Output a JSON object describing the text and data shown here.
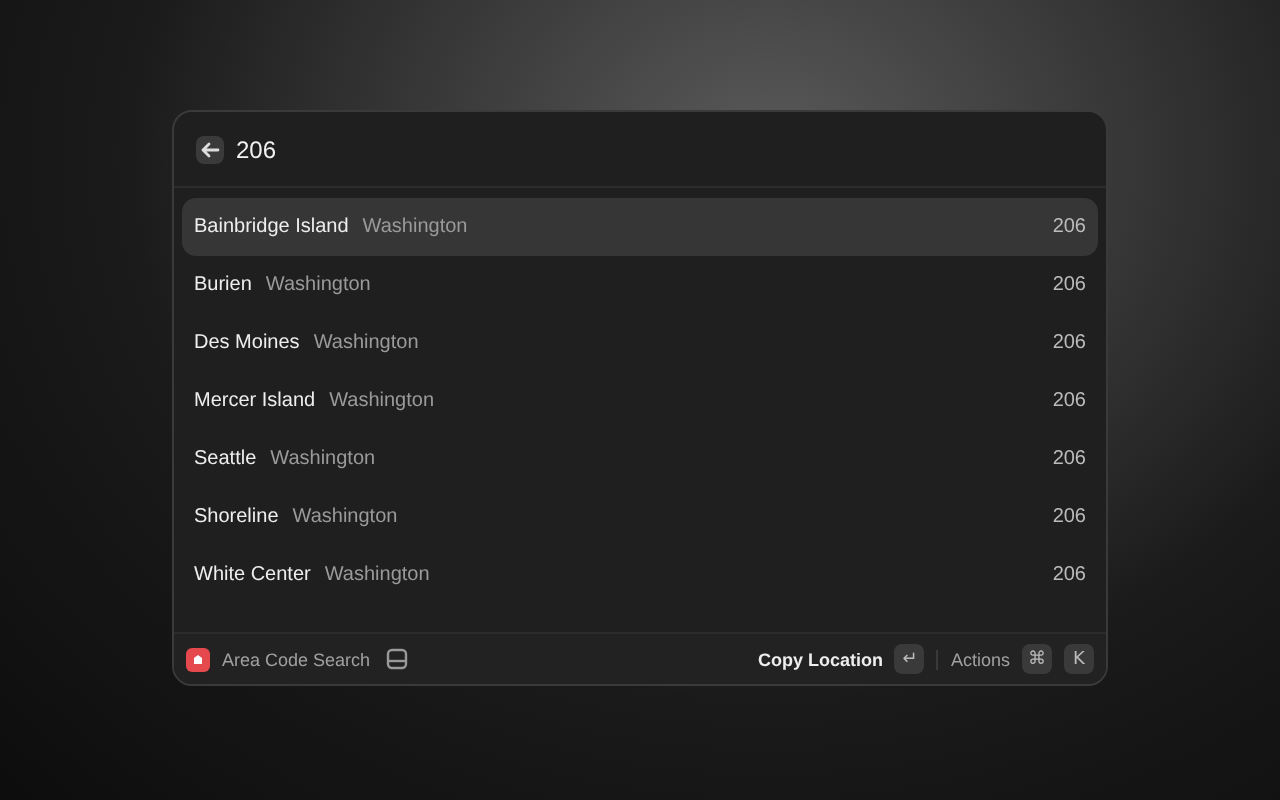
{
  "search": {
    "value": "206"
  },
  "results": [
    {
      "city": "Bainbridge Island",
      "state": "Washington",
      "code": "206",
      "selected": true
    },
    {
      "city": "Burien",
      "state": "Washington",
      "code": "206",
      "selected": false
    },
    {
      "city": "Des Moines",
      "state": "Washington",
      "code": "206",
      "selected": false
    },
    {
      "city": "Mercer Island",
      "state": "Washington",
      "code": "206",
      "selected": false
    },
    {
      "city": "Seattle",
      "state": "Washington",
      "code": "206",
      "selected": false
    },
    {
      "city": "Shoreline",
      "state": "Washington",
      "code": "206",
      "selected": false
    },
    {
      "city": "White Center",
      "state": "Washington",
      "code": "206",
      "selected": false
    }
  ],
  "footer": {
    "extension": "Area Code Search",
    "primary_action": "Copy Location",
    "primary_key": "↵",
    "actions_label": "Actions",
    "action_keys": [
      "⌘",
      "K"
    ]
  }
}
